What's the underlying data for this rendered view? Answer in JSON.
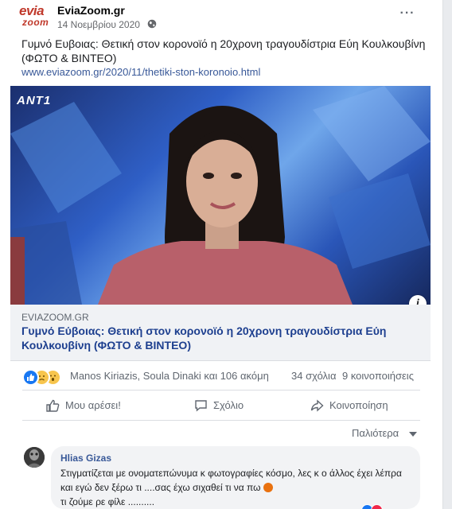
{
  "post": {
    "page_name": "EviaZoom.gr",
    "logo_line1": "evia",
    "logo_line2": "zoom",
    "date": "14 Νοεμβρίου 2020",
    "more_icon_text": "···",
    "text": "Γυμνό Ευβοιας: Θετική στον κορονοϊό η 20χρονη τραγουδίστρια Εύη Κουλκουβίνη (ΦΩΤΟ & ΒΙΝΤΕΟ)",
    "link": "www.eviazoom.gr/2020/11/thetiki-ston-koronoio.html"
  },
  "image": {
    "channel_logo": "ANT1",
    "info_glyph": "i"
  },
  "preview": {
    "domain": "EVIAZOOM.GR",
    "title": "Γυμνό Εύβοιας: Θετική στον κορονοϊό η 20χρονη τραγουδίστρια Εύη Κουλκουβίνη (ΦΩΤΟ & ΒΙΝΤΕΟ)"
  },
  "stats": {
    "reactions": [
      "like",
      "sad",
      "wow"
    ],
    "reactors_text": "Manos Kiriazis, Soula Dinaki και 106 ακόμη",
    "comments": "34 σχόλια",
    "shares": "9 κοινοποιήσεις"
  },
  "actions": {
    "like": "Μου αρέσει!",
    "comment": "Σχόλιο",
    "share": "Κοινοποίηση"
  },
  "sort_label": "Παλιότερα",
  "comment": {
    "author": "Hlias Gizas",
    "text": "Στιγματίζεται με ονοματεπώνυμα κ φωτογραφίες κόσμο, λες κ ο άλλος έχει λέπρα και εγώ δεν ξέρω τι ....σας έχω σιχαθεί τι να πω",
    "text_end": "τι ζούμε ρε φίλε ..........",
    "reaction_icon": "angry"
  },
  "colors": {
    "link": "#385898",
    "like_blue": "#1877f2",
    "logo_red": "#c0392b"
  }
}
